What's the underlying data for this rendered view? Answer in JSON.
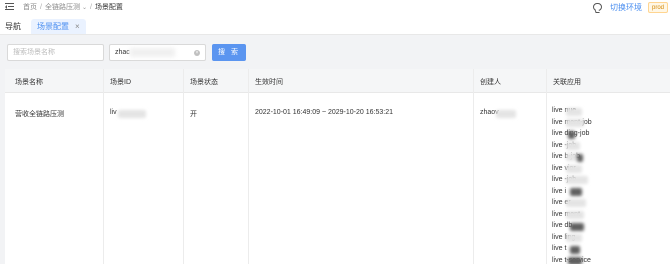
{
  "breadcrumb": {
    "items": [
      "首页",
      "全链路压测",
      "场景配置"
    ]
  },
  "header": {
    "switch_env_label": "切换环境",
    "env_tag": "prod"
  },
  "tabs": {
    "nav_label": "导航",
    "active_tab_label": "场景配置",
    "close_glyph": "×"
  },
  "search": {
    "name_placeholder": "搜索场景名称",
    "id_value": "zhac",
    "button_label": "搜 索"
  },
  "table": {
    "columns": [
      "场景名称",
      "场景ID",
      "场景状态",
      "生效时间",
      "创建人",
      "关联应用"
    ],
    "row": {
      "name": "营收全链路压测",
      "id": "liv",
      "status": "开",
      "effective_time": "2022-10-01 16:49:09 ~ 2029-10-20 16:53:21",
      "creator": "zhaov",
      "apps": [
        "live    nue",
        "live    ment-job",
        "live    ding-job",
        "live    -job",
        "live    b-job",
        "live    vior",
        "live    -job",
        "live    i",
        "live    er",
        "live    ment",
        "live    db",
        "live    ling",
        "live    t",
        "live    t-service"
      ]
    }
  },
  "colors": {
    "accent": "#4a8ef0",
    "button": "#5b95f0",
    "tag": "#d48806"
  }
}
